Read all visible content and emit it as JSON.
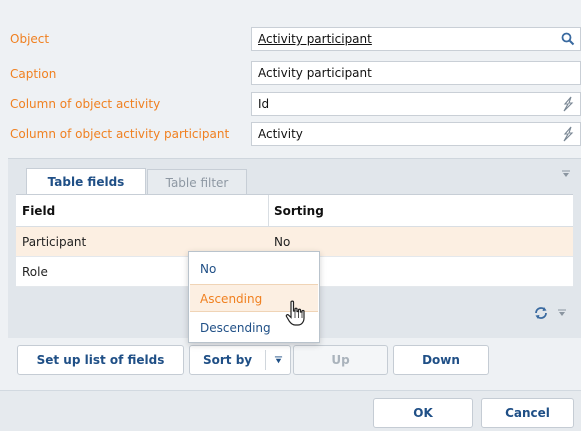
{
  "properties": [
    {
      "label": "Object",
      "value": "Activity participant",
      "icon": "search-icon"
    },
    {
      "label": "Caption",
      "value": "Activity participant",
      "icon": ""
    },
    {
      "label": "Column of object activity",
      "value": "Id",
      "icon": "lookup-icon"
    },
    {
      "label": "Column of object activity participant",
      "value": "Activity",
      "icon": "lookup-icon"
    }
  ],
  "tabs": {
    "active": "Table fields",
    "inactive": "Table filter"
  },
  "grid": {
    "columns": [
      "Field",
      "Sorting"
    ],
    "rows": [
      {
        "field": "Participant",
        "sorting": "No"
      },
      {
        "field": "Role",
        "sorting": ""
      }
    ]
  },
  "toolbar": {
    "set_up": "Set up list of fields",
    "sort_by": "Sort by",
    "up": "Up",
    "down": "Down"
  },
  "sort_menu": {
    "items": [
      "No",
      "Ascending",
      "Descending"
    ],
    "hovered": "Ascending"
  },
  "dialog": {
    "ok": "OK",
    "cancel": "Cancel"
  },
  "colors": {
    "label": "#f08020",
    "link": "#1f4f86",
    "hover": "#fcefe2"
  }
}
